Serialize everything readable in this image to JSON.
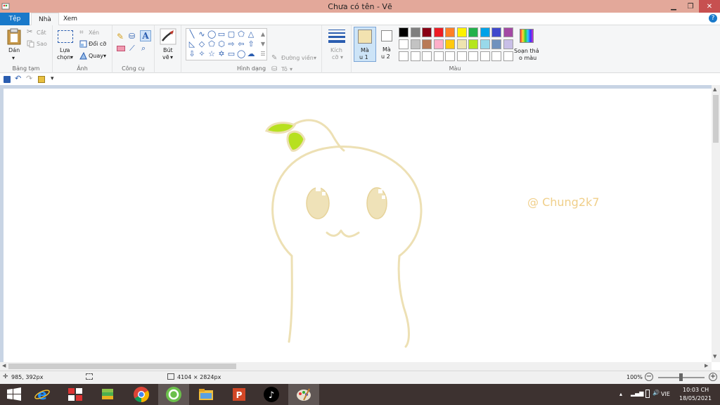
{
  "window": {
    "title": "Chưa có tên - Vẽ"
  },
  "tabs": {
    "file": "Tệp",
    "home": "Nhà",
    "view": "Xem"
  },
  "ribbon": {
    "clipboard": {
      "paste": "Dán",
      "cut": "Cắt",
      "copy": "Sao",
      "group": "Bảng tạm"
    },
    "image": {
      "select1": "Lựa",
      "select2": "chọn",
      "crop": "Xén",
      "resize": "Đổi cỡ",
      "rotate": "Quay",
      "group": "Ảnh"
    },
    "tools": {
      "group": "Công cụ"
    },
    "brushes": {
      "label1": "Bút",
      "label2": "vẽ"
    },
    "shapes": {
      "outline": "Đường viền",
      "fill": "Tô",
      "group": "Hình dạng"
    },
    "size": {
      "label1": "Kích",
      "label2": "cỡ"
    },
    "color1": {
      "label1": "Mà",
      "label2": "u 1",
      "value": "#f2e2b0"
    },
    "color2": {
      "label1": "Mà",
      "label2": "u 2",
      "value": "#ffffff"
    },
    "edit_colors": {
      "label1": "Soạn thả",
      "label2": "o màu"
    },
    "colors": {
      "group": "Màu",
      "row1": [
        "#000000",
        "#7f7f7f",
        "#880015",
        "#ed1c24",
        "#ff7f27",
        "#fff200",
        "#22b14c",
        "#00a2e8",
        "#3f48cc",
        "#a349a4"
      ],
      "row2": [
        "#ffffff",
        "#c3c3c3",
        "#b97a57",
        "#ffaec9",
        "#ffc90e",
        "#efe4b0",
        "#b5e61d",
        "#99d9ea",
        "#7092be",
        "#c8bfe7"
      ]
    }
  },
  "canvas": {
    "watermark": "@ Chung2k7"
  },
  "status": {
    "cursor": "985, 392px",
    "dimensions": "4104 × 2824px",
    "zoom": "100%"
  },
  "taskbar": {
    "lang": "VIE",
    "time": "10:03 CH",
    "date": "18/05/2021"
  }
}
